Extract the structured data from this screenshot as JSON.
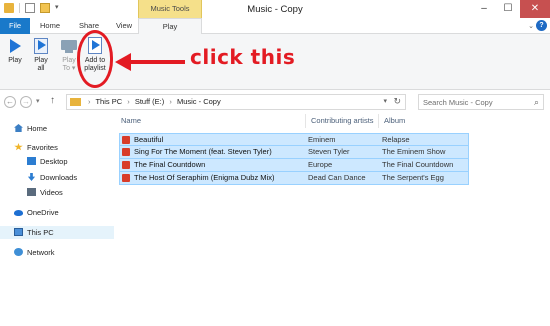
{
  "window": {
    "title": "Music - Copy",
    "contextual_tab_group": "Music Tools",
    "controls": {
      "minimize": "–",
      "maximize": "☐",
      "close": "✕"
    }
  },
  "ribbon_tabs": [
    {
      "label": "File"
    },
    {
      "label": "Home"
    },
    {
      "label": "Share"
    },
    {
      "label": "View"
    },
    {
      "label": "Play"
    }
  ],
  "ribbon_buttons": [
    {
      "label": "Play",
      "icon": "play-icon"
    },
    {
      "label": "Play all",
      "icon": "play-all-icon"
    },
    {
      "label": "Play To",
      "icon": "play-to-icon",
      "enabled": false
    },
    {
      "label": "Add to playlist",
      "icon": "add-to-playlist-icon"
    }
  ],
  "annotation": {
    "text": "click this",
    "color": "#e31b23"
  },
  "address_bar": {
    "crumbs": [
      "This PC",
      "Stuff (E:)",
      "Music - Copy"
    ],
    "search_placeholder": "Search Music - Copy"
  },
  "nav_pane": {
    "items": [
      {
        "label": "Home",
        "icon": "home-icon"
      },
      {
        "label": "Favorites",
        "icon": "star-icon"
      },
      {
        "label": "Desktop",
        "icon": "desktop-icon"
      },
      {
        "label": "Downloads",
        "icon": "downloads-icon"
      },
      {
        "label": "Videos",
        "icon": "videos-icon"
      },
      {
        "label": "OneDrive",
        "icon": "onedrive-icon"
      },
      {
        "label": "This PC",
        "icon": "this-pc-icon",
        "selected": true
      },
      {
        "label": "Network",
        "icon": "network-icon"
      }
    ]
  },
  "file_list": {
    "columns": [
      "Name",
      "Contributing artists",
      "Album"
    ],
    "rows": [
      {
        "name": "Beautiful",
        "artist": "Eminem",
        "album": "Relapse"
      },
      {
        "name": "Sing For The Moment (feat. Steven Tyler)",
        "artist": "Steven Tyler",
        "album": "The Eminem Show"
      },
      {
        "name": "The Final Countdown",
        "artist": "Europe",
        "album": "The Final Countdown"
      },
      {
        "name": "The Host Of Seraphim (Enigma Dubz Mix)",
        "artist": "Dead Can Dance",
        "album": "The Serpent's Egg"
      }
    ]
  },
  "colors": {
    "selection": "#cde8ff",
    "accent": "#1979ca",
    "contextual": "#f5e08a"
  }
}
